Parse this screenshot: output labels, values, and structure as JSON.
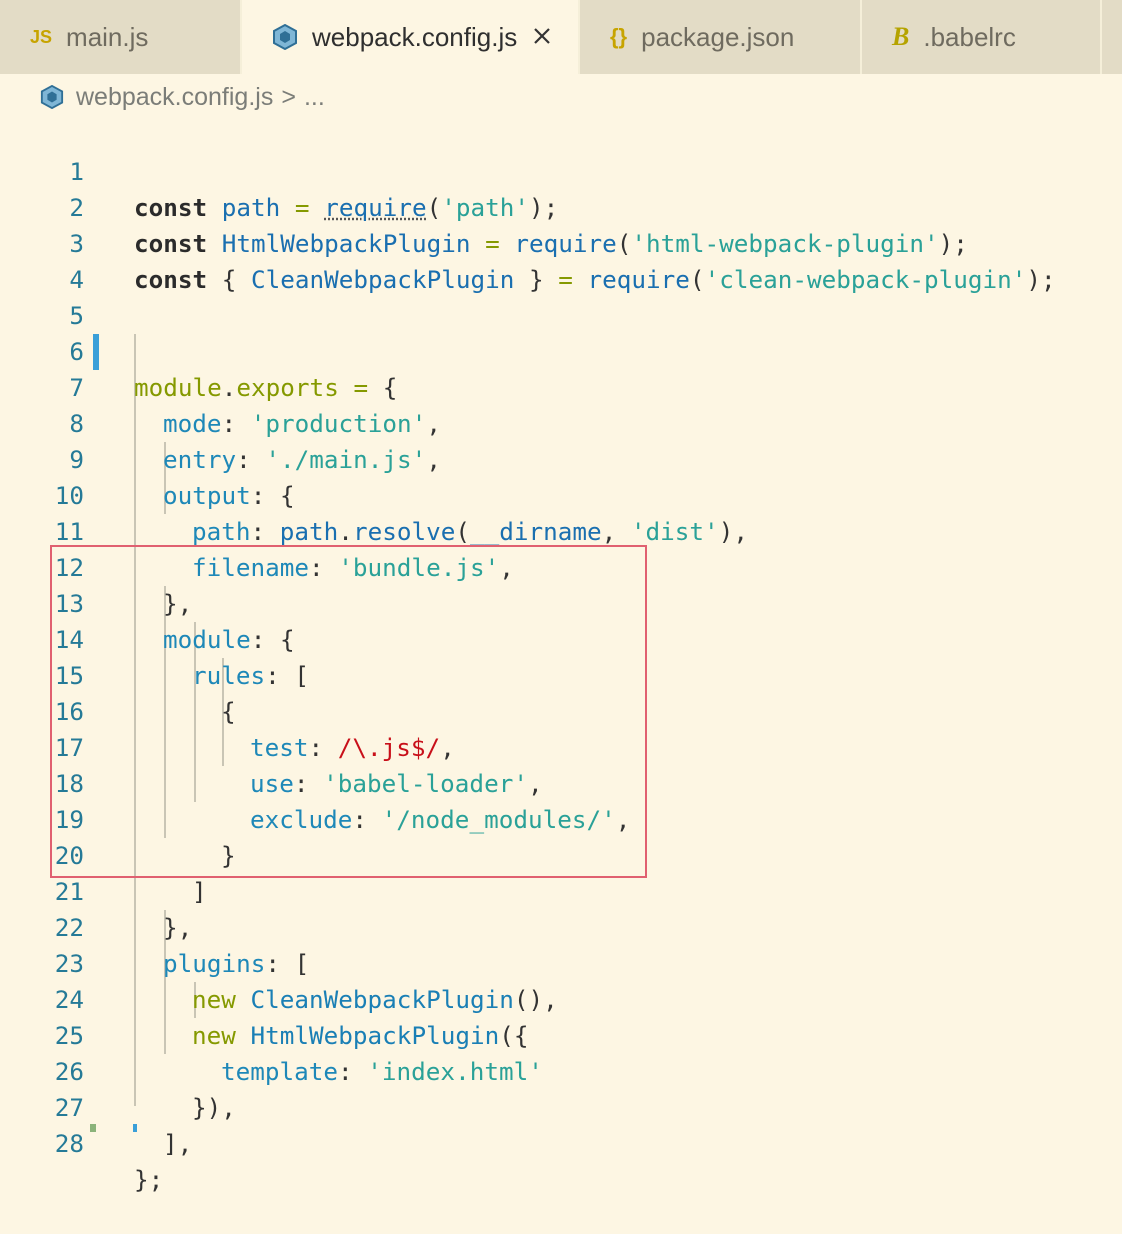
{
  "tabs": [
    {
      "label": "main.js",
      "icon": "js-icon",
      "icon_text": "JS",
      "active": false
    },
    {
      "label": "webpack.config.js",
      "icon": "webpack-cube-icon",
      "active": true
    },
    {
      "label": "package.json",
      "icon": "json-braces-icon",
      "icon_text": "{}",
      "active": false
    },
    {
      "label": ".babelrc",
      "icon": "babel-icon",
      "icon_text": "B",
      "active": false
    }
  ],
  "breadcrumb": {
    "file": "webpack.config.js",
    "separator": ">",
    "ellipsis": "..."
  },
  "editor": {
    "line_numbers": [
      "1",
      "2",
      "3",
      "4",
      "5",
      "6",
      "7",
      "8",
      "9",
      "10",
      "11",
      "12",
      "13",
      "14",
      "15",
      "16",
      "17",
      "18",
      "19",
      "20",
      "21",
      "22",
      "23",
      "24",
      "25",
      "26",
      "27",
      "28"
    ],
    "lines": {
      "l1": {
        "a": "const",
        "b": " ",
        "c": "path",
        "d": " = ",
        "e": "require",
        "f": "(",
        "g": "'path'",
        "h": ");"
      },
      "l2": {
        "a": "const",
        "b": " ",
        "c": "HtmlWebpackPlugin",
        "d": " = ",
        "e": "require",
        "f": "(",
        "g": "'html-webpack-plugin'",
        "h": ");"
      },
      "l3": {
        "a": "const",
        "b": " { ",
        "c": "CleanWebpackPlugin",
        "d": " } ",
        "i": "=",
        "j": " ",
        "e": "require",
        "f": "(",
        "g": "'clean-webpack-plugin'",
        "h": ");"
      },
      "l6": {
        "a": "module",
        "b": ".",
        "c": "exports",
        "d": " = ",
        "e": "{"
      },
      "l7": {
        "a": "mode",
        "b": ": ",
        "c": "'production'",
        "d": ","
      },
      "l8": {
        "a": "entry",
        "b": ": ",
        "c": "'./main.js'",
        "d": ","
      },
      "l9": {
        "a": "output",
        "b": ": {"
      },
      "l10": {
        "a": "path",
        "b": ": ",
        "c": "path",
        "d": ".",
        "e": "resolve",
        "f": "(",
        "g": "__dirname",
        "h": ", ",
        "i": "'dist'",
        "j": "),"
      },
      "l11": {
        "a": "filename",
        "b": ": ",
        "c": "'bundle.js'",
        "d": ","
      },
      "l12": {
        "a": "},"
      },
      "l13": {
        "a": "module",
        "b": ": {"
      },
      "l14": {
        "a": "rules",
        "b": ": ["
      },
      "l15": {
        "a": "{"
      },
      "l16": {
        "a": "test",
        "b": ": ",
        "c": "/\\.js$/",
        "d": ","
      },
      "l17": {
        "a": "use",
        "b": ": ",
        "c": "'babel-loader'",
        "d": ","
      },
      "l18": {
        "a": "exclude",
        "b": ": ",
        "c": "'/node_modules/'",
        "d": ","
      },
      "l19": {
        "a": "}"
      },
      "l20": {
        "a": "]"
      },
      "l21": {
        "a": "},"
      },
      "l22": {
        "a": "plugins",
        "b": ": ["
      },
      "l23": {
        "a": "new",
        "b": " ",
        "c": "CleanWebpackPlugin",
        "d": "(),"
      },
      "l24": {
        "a": "new",
        "b": " ",
        "c": "HtmlWebpackPlugin",
        "d": "({"
      },
      "l25": {
        "a": "template",
        "b": ": ",
        "c": "'index.html'"
      },
      "l26": {
        "a": "}),"
      },
      "l27": {
        "a": "],"
      },
      "l28": {
        "a": "};"
      }
    }
  },
  "colors": {
    "background": "#fdf6e3",
    "tabbar": "#e3dcc6",
    "highlight_box": "#e06070",
    "modified_gutter": "#3a9fd8"
  }
}
